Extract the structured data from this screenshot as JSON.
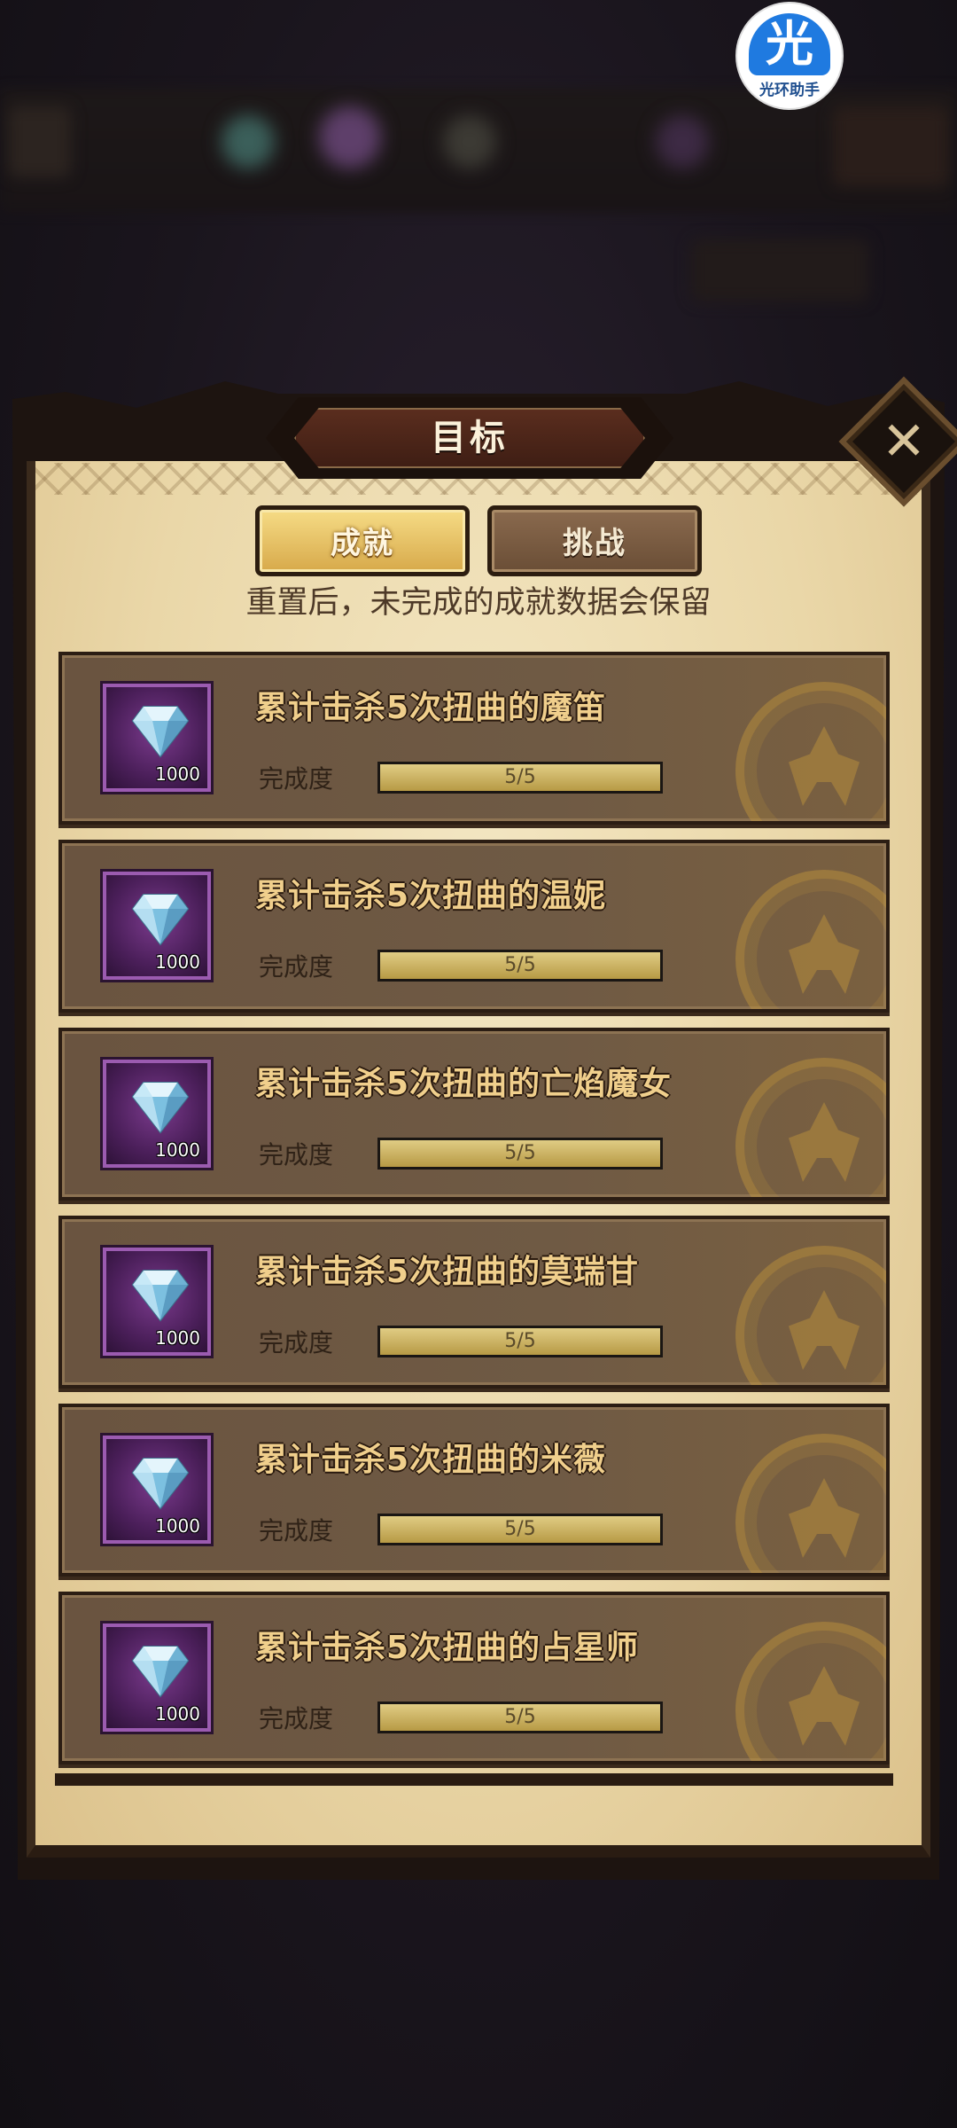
{
  "watermark": {
    "glyph": "光",
    "label": "光环助手"
  },
  "dialog": {
    "title": "目标",
    "close_icon": "close-x-icon"
  },
  "tabs": [
    {
      "label": "成就",
      "active": true
    },
    {
      "label": "挑战",
      "active": false
    }
  ],
  "notice": "重置后，未完成的成就数据会保留",
  "achievements": [
    {
      "title": "累计击杀5次扭曲的魔笛",
      "reward_icon": "diamond-icon",
      "reward_amount": "1000",
      "progress_label": "完成度",
      "progress_text": "5/5",
      "progress": 1.0
    },
    {
      "title": "累计击杀5次扭曲的温妮",
      "reward_icon": "diamond-icon",
      "reward_amount": "1000",
      "progress_label": "完成度",
      "progress_text": "5/5",
      "progress": 1.0
    },
    {
      "title": "累计击杀5次扭曲的亡焰魔女",
      "reward_icon": "diamond-icon",
      "reward_amount": "1000",
      "progress_label": "完成度",
      "progress_text": "5/5",
      "progress": 1.0
    },
    {
      "title": "累计击杀5次扭曲的莫瑞甘",
      "reward_icon": "diamond-icon",
      "reward_amount": "1000",
      "progress_label": "完成度",
      "progress_text": "5/5",
      "progress": 1.0
    },
    {
      "title": "累计击杀5次扭曲的米薇",
      "reward_icon": "diamond-icon",
      "reward_amount": "1000",
      "progress_label": "完成度",
      "progress_text": "5/5",
      "progress": 1.0
    },
    {
      "title": "累计击杀5次扭曲的占星师",
      "reward_icon": "diamond-icon",
      "reward_amount": "1000",
      "progress_label": "完成度",
      "progress_text": "5/5",
      "progress": 1.0
    }
  ],
  "colors": {
    "reward_box": "#5a2468",
    "progress_fill": "#d4bc6c",
    "title_text": "#f0cf8c"
  }
}
